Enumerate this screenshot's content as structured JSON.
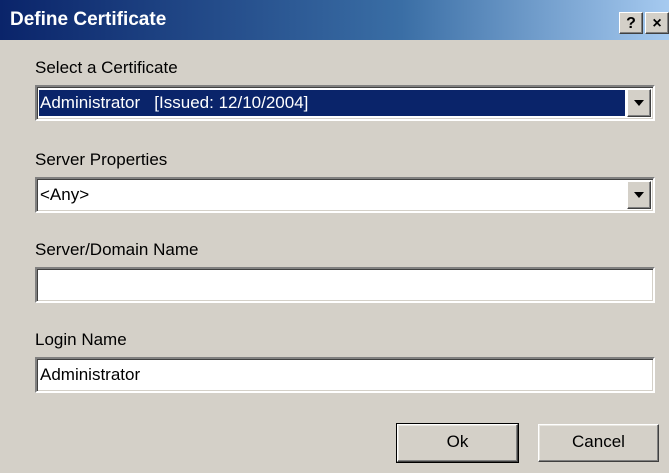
{
  "window": {
    "title": "Define Certificate",
    "help_label": "?",
    "close_label": "×"
  },
  "certificate": {
    "label": "Select a Certificate",
    "value": "Administrator   [Issued: 12/10/2004]"
  },
  "server_properties": {
    "label": "Server Properties",
    "value": "<Any>"
  },
  "server_domain": {
    "label": "Server/Domain Name",
    "value": ""
  },
  "login": {
    "label": "Login Name",
    "value": "Administrator"
  },
  "buttons": {
    "ok": "Ok",
    "cancel": "Cancel"
  },
  "colors": {
    "titlebar_start": "#0a246a",
    "titlebar_end": "#a6caf0",
    "face": "#d4d0c8",
    "selection": "#0a246a"
  }
}
